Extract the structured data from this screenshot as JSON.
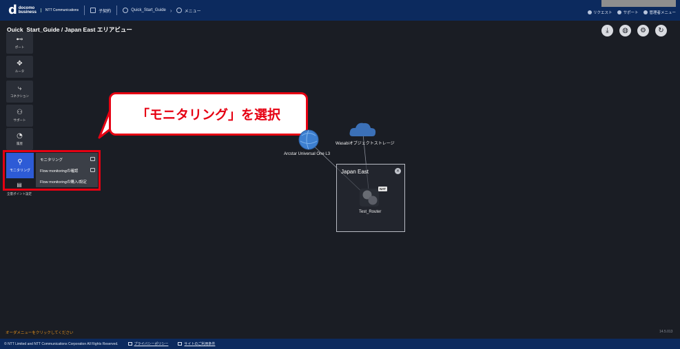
{
  "header": {
    "brand_top": "docomo",
    "brand_bottom": "business",
    "brand_ntt": "NTT Communications",
    "contract_label": "子契約",
    "breadcrumb": [
      "Quick_Start_Guide",
      "メニュー"
    ],
    "right_links": [
      "リクエスト",
      "サポート",
      "管理者メニュー"
    ]
  },
  "page_title": "Quick_Start_Guide / Japan East エリアビュー",
  "toolbar_icons": [
    "download-icon",
    "globe-icon",
    "gear-icon",
    "refresh-icon"
  ],
  "sidebar": {
    "items": [
      {
        "label": "ポート",
        "icon": "port-icon"
      },
      {
        "label": "ルータ",
        "icon": "router-icon"
      },
      {
        "label": "コネクション",
        "icon": "connection-icon"
      },
      {
        "label": "サポート",
        "icon": "support-icon"
      },
      {
        "label": "履歴",
        "icon": "history-icon"
      },
      {
        "label": "モニタリング",
        "icon": "monitoring-icon"
      }
    ],
    "endpoint_label": "全量ポイント設定"
  },
  "monitoring_menu": {
    "items": [
      "モニタリング",
      "Flow monitoringの確認",
      "Flow monitoringの購入/設定"
    ]
  },
  "callout": "「モニタリング」を選択",
  "topology": {
    "nodes": [
      "Arcstar Universal One L3",
      "Wasabiオブジェクトストレージ",
      "Test_Router"
    ],
    "region": "Japan East",
    "badge": "NAT"
  },
  "footer_note": "オーダメニューをクリックしてください",
  "version": "14.5.013",
  "footer": {
    "copyright": "© NTT Limited and NTT Communications Corporation All Rights Reserved.",
    "links": [
      "プライバシーポリシー",
      "サイトのご利用条件"
    ]
  },
  "colors": {
    "header_bg": "#0c2a5e",
    "canvas_bg": "#1a1d24",
    "highlight_red": "#e60012",
    "active_blue": "#2d5bd6",
    "note_orange": "#e8931c"
  }
}
